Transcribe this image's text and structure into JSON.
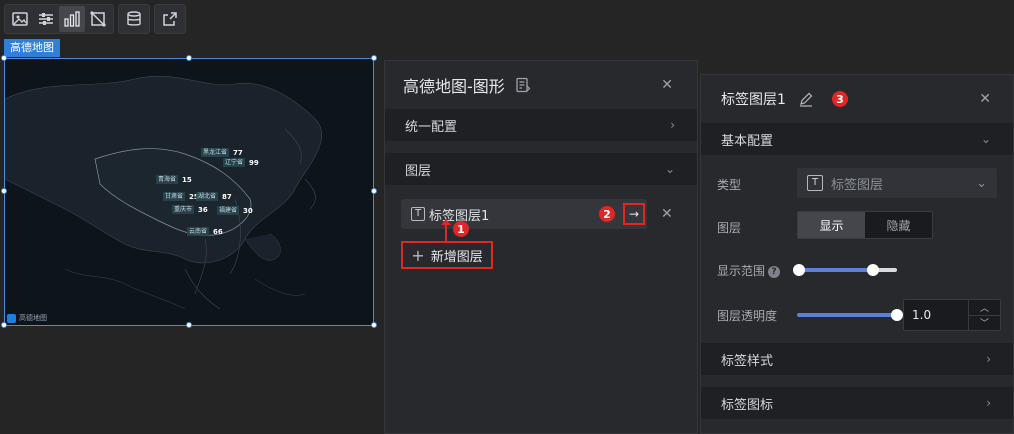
{
  "toolbar": {
    "icons": [
      "image-icon",
      "sliders-icon",
      "bar-chart-icon",
      "shape-icon",
      "database-icon",
      "link-icon"
    ]
  },
  "map": {
    "tag": "高德地图",
    "labels": [
      {
        "name": "黑龙江省",
        "value": "77"
      },
      {
        "name": "辽宁省",
        "value": "99"
      },
      {
        "name": "青海省",
        "value": "15"
      },
      {
        "name": "甘肃省",
        "value": "25"
      },
      {
        "name": "湖北省",
        "value": "87"
      },
      {
        "name": "重庆市",
        "value": "36"
      },
      {
        "name": "福建省",
        "value": "30"
      },
      {
        "name": "云南省",
        "value": "66"
      }
    ],
    "logo_text": "高德地图"
  },
  "panel1": {
    "title": "高德地图-图形",
    "unified_config": "统一配置",
    "layers_section": "图层",
    "layer_item": "标签图层1",
    "add_layer": "新增图层",
    "badge1": "1",
    "badge2": "2",
    "arrow": "→"
  },
  "panel2": {
    "title": "标签图层1",
    "badge3": "3",
    "basic_config": "基本配置",
    "type_label": "类型",
    "type_value": "标签图层",
    "layer_label": "图层",
    "show": "显示",
    "hide": "隐藏",
    "range_label": "显示范围",
    "range_low": 0,
    "range_high": 0.75,
    "opacity_label": "图层透明度",
    "opacity_value": "1.0",
    "opacity_level": 1.0,
    "label_style": "标签样式",
    "label_icon": "标签图标"
  },
  "colors": {
    "accent": "#2f7fd8",
    "highlight": "#e02727",
    "slider_fill": "#5b82d8"
  }
}
